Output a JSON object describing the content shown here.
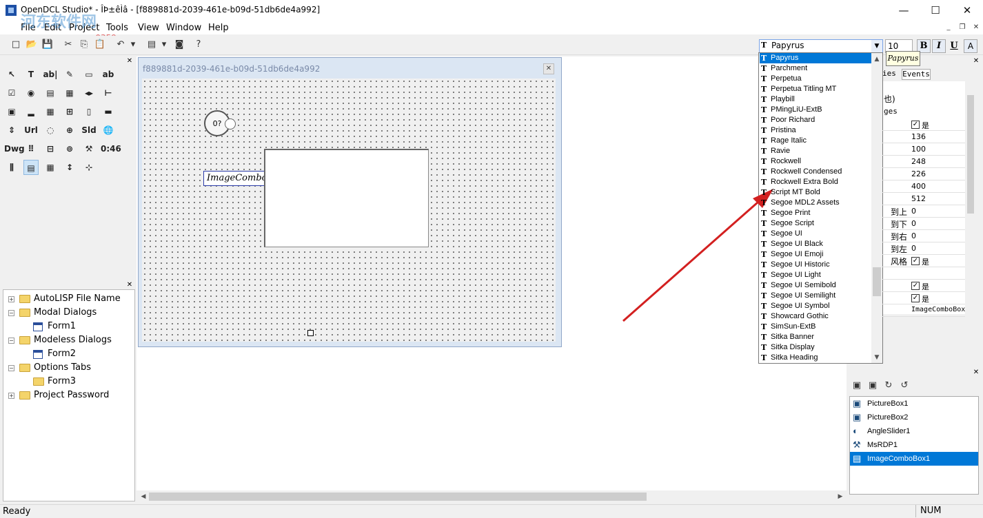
{
  "window": {
    "title": "OpenDCL Studio* - ÎÞ±êÌâ - [f889881d-2039-461e-b09d-51db6de4a992]",
    "minimize": "—",
    "maximize": "☐",
    "close": "✕",
    "watermark": "河东软件网",
    "watermark_url": "www.pc0359.cn"
  },
  "menu": {
    "items": [
      "File",
      "Edit",
      "Project",
      "Tools",
      "View",
      "Window",
      "Help"
    ],
    "mdi_minimize": "_",
    "mdi_restore": "❐",
    "mdi_close": "✕"
  },
  "toolbar": {
    "buttons": [
      "new-icon",
      "open-icon",
      "save-icon",
      "cut-icon",
      "copy-icon",
      "paste-icon",
      "undo-icon",
      "redo-dropdown-icon",
      "form-icon",
      "dropdown-icon",
      "camera-icon",
      "help-icon"
    ],
    "glyphs": [
      "□",
      "📂",
      "💾",
      "✂",
      "⎘",
      "📋",
      "↶",
      "▾",
      "▤",
      "▾",
      "◙",
      "?"
    ]
  },
  "toolbox": {
    "close": "✕",
    "tools": [
      "↖",
      "T",
      "ab|",
      "✎",
      "▭",
      "ab",
      "☑",
      "◉",
      "▤",
      "▦",
      "◂▸",
      "⊢",
      "▣",
      "▂",
      "▦",
      "⊞",
      "▯",
      "▬",
      "⇕",
      "Url",
      "◌",
      "⊕",
      "Sld",
      "🌐",
      "Dwg",
      "⠿",
      "⊟",
      "⊚",
      "⚒",
      "0:46",
      "⫼",
      "▤",
      "▦",
      "↕",
      "⊹"
    ]
  },
  "tree": {
    "close": "✕",
    "items": [
      {
        "label": "AutoLISP File Name",
        "type": "folder",
        "level": 0,
        "expander": "+"
      },
      {
        "label": "Modal Dialogs",
        "type": "folder",
        "level": 0,
        "expander": "−"
      },
      {
        "label": "Form1",
        "type": "form",
        "level": 1,
        "expander": ""
      },
      {
        "label": "Modeless Dialogs",
        "type": "folder",
        "level": 0,
        "expander": "−"
      },
      {
        "label": "Form2",
        "type": "form",
        "level": 1,
        "expander": ""
      },
      {
        "label": "Options Tabs",
        "type": "folder",
        "level": 0,
        "expander": "−"
      },
      {
        "label": "Form3",
        "type": "folder",
        "level": 1,
        "expander": ""
      },
      {
        "label": "Project Password",
        "type": "folder",
        "level": 0,
        "expander": "+"
      }
    ]
  },
  "form_window": {
    "title": "f889881d-2039-461e-b09d-51db6de4a992",
    "close": "✕",
    "angle_slider_text": "0?",
    "image_combo_text": "ImageComboBox"
  },
  "font_panel": {
    "font_value": "Papyrus",
    "size_value": "10",
    "bold": "B",
    "italic": "I",
    "underline": "U",
    "color": "A",
    "tooltip": "Papyrus",
    "fonts": [
      "Papyrus",
      "Parchment",
      "Perpetua",
      "Perpetua Titling MT",
      "Playbill",
      "PMingLiU-ExtB",
      "Poor Richard",
      "Pristina",
      "Rage Italic",
      "Ravie",
      "Rockwell",
      "Rockwell Condensed",
      "Rockwell Extra Bold",
      "Script MT Bold",
      "Segoe MDL2 Assets",
      "Segoe Print",
      "Segoe Script",
      "Segoe UI",
      "Segoe UI Black",
      "Segoe UI Emoji",
      "Segoe UI Historic",
      "Segoe UI Light",
      "Segoe UI Semibold",
      "Segoe UI Semilight",
      "Segoe UI Symbol",
      "Showcard Gothic",
      "SimSun-ExtB",
      "Sitka Banner",
      "Sitka Display",
      "Sitka Heading"
    ],
    "selected_font": "Papyrus"
  },
  "properties": {
    "close": "✕",
    "tab_props_partial": "ies",
    "tab_events": "Events",
    "row_partials": [
      "也)",
      "ges"
    ],
    "rows": [
      {
        "key": "",
        "value": "是",
        "check": true
      },
      {
        "key": "",
        "value": "136",
        "check": false
      },
      {
        "key": "",
        "value": "100",
        "check": false
      },
      {
        "key": "",
        "value": "248",
        "check": false
      },
      {
        "key": "",
        "value": "226",
        "check": false
      },
      {
        "key": "",
        "value": "400",
        "check": false
      },
      {
        "key": "",
        "value": "512",
        "check": false
      },
      {
        "key": "到上",
        "value": "0",
        "check": false
      },
      {
        "key": "到下",
        "value": "0",
        "check": false
      },
      {
        "key": "到右",
        "value": "0",
        "check": false
      },
      {
        "key": "到左",
        "value": "0",
        "check": false
      },
      {
        "key": "风格",
        "value": "是",
        "check": true
      },
      {
        "key": "",
        "value": "",
        "check": false
      },
      {
        "key": "",
        "value": "是",
        "check": true
      },
      {
        "key": "",
        "value": "是",
        "check": true
      },
      {
        "key": "",
        "value": "ImageComboBox",
        "check": false
      }
    ]
  },
  "objects": {
    "close": "✕",
    "toolbar": [
      "▣",
      "▣",
      "↻",
      "↺"
    ],
    "items": [
      {
        "label": "PictureBox1",
        "icon": "picture-icon"
      },
      {
        "label": "PictureBox2",
        "icon": "picture-icon"
      },
      {
        "label": "AngleSlider1",
        "icon": "slider-icon"
      },
      {
        "label": "MsRDP1",
        "icon": "tools-icon"
      },
      {
        "label": "ImageComboBox1",
        "icon": "combo-icon"
      }
    ],
    "selected": "ImageComboBox1"
  },
  "status": {
    "text": "Ready",
    "num": "NUM"
  },
  "colors": {
    "accent": "#0078d7",
    "arrow": "#d32020"
  }
}
